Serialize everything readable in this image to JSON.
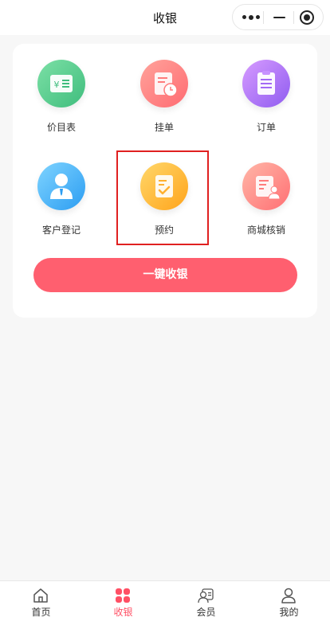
{
  "nav": {
    "title": "收银"
  },
  "grid": {
    "items": [
      {
        "label": "价目表",
        "icon": "price-list-icon",
        "color": "#4fc686"
      },
      {
        "label": "挂单",
        "icon": "pending-order-icon",
        "color": "#ff7b7b"
      },
      {
        "label": "订单",
        "icon": "order-list-icon",
        "color": "#a36af5"
      },
      {
        "label": "客户登记",
        "icon": "customer-icon",
        "color": "#3aa8f5"
      },
      {
        "label": "预约",
        "icon": "booking-icon",
        "color": "#ffb02e"
      },
      {
        "label": "商城核销",
        "icon": "mall-verify-icon",
        "color": "#ff7c7c"
      }
    ]
  },
  "action": {
    "one_key_label": "一键收银",
    "color": "#ff5f6f"
  },
  "tabbar": {
    "items": [
      {
        "label": "首页",
        "icon": "home-icon"
      },
      {
        "label": "收银",
        "icon": "cashier-icon",
        "active": true
      },
      {
        "label": "会员",
        "icon": "member-icon"
      },
      {
        "label": "我的",
        "icon": "profile-icon"
      }
    ],
    "active_color": "#ff4f64"
  }
}
